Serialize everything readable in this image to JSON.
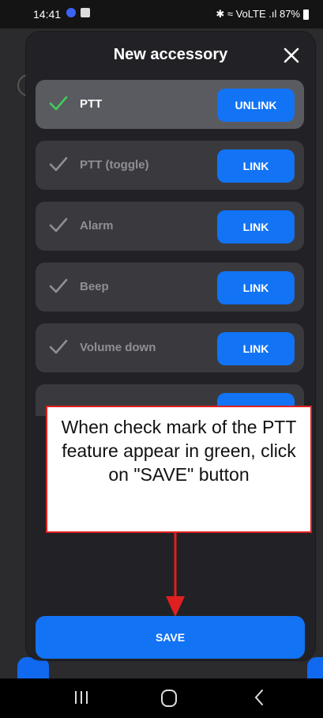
{
  "status_bar": {
    "time": "14:41",
    "right_text": "✱ ≈ VoLTE .ıl 87%"
  },
  "dialog": {
    "title": "New accessory",
    "rows": [
      {
        "label": "PTT",
        "button": "UNLINK",
        "checked": true
      },
      {
        "label": "PTT (toggle)",
        "button": "LINK",
        "checked": false
      },
      {
        "label": "Alarm",
        "button": "LINK",
        "checked": false
      },
      {
        "label": "Beep",
        "button": "LINK",
        "checked": false
      },
      {
        "label": "Volume down",
        "button": "LINK",
        "checked": false
      }
    ],
    "save_label": "SAVE"
  },
  "callout": {
    "text": "When check mark of the PTT feature appear in green, click on \"SAVE\" button"
  },
  "colors": {
    "accent": "#1273f5",
    "check_active": "#3fce5a",
    "check_inactive": "#8e8f95",
    "callout_border": "#e02020"
  }
}
